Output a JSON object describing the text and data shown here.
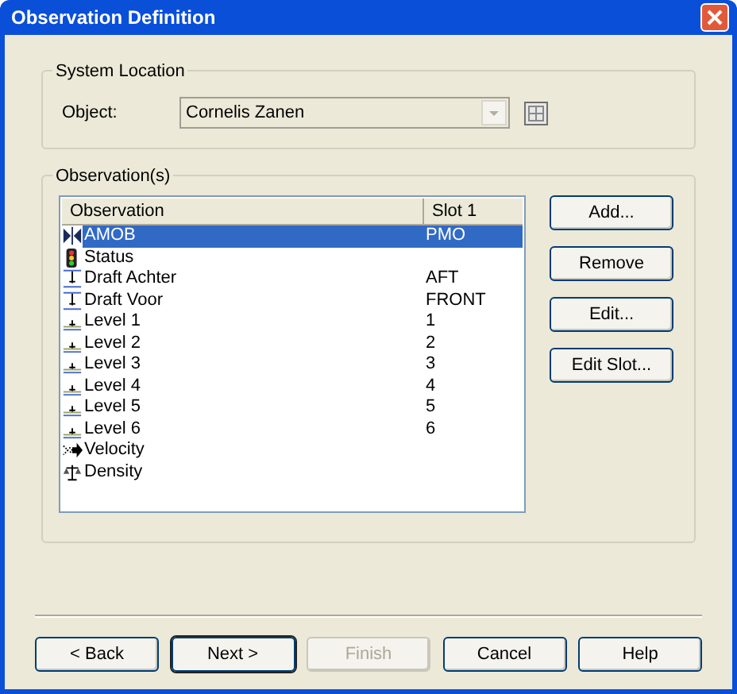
{
  "window": {
    "title": "Observation Definition"
  },
  "system_location": {
    "title": "System Location",
    "object_label": "Object:",
    "object_value": "Cornelis Zanen"
  },
  "observations": {
    "title": "Observation(s)",
    "columns": [
      "Observation",
      "Slot 1"
    ],
    "rows": [
      {
        "kind": "amob",
        "name": "AMOB",
        "slot": "PMO",
        "selected": true
      },
      {
        "kind": "status",
        "name": "Status",
        "selected": false
      },
      {
        "kind": "draft",
        "name": "Draft Achter",
        "slot": "AFT",
        "selected": false
      },
      {
        "kind": "draft",
        "name": "Draft Voor",
        "slot": "FRONT",
        "selected": false
      },
      {
        "kind": "level",
        "name": "Level 1",
        "slot": "1",
        "selected": false
      },
      {
        "kind": "level",
        "name": "Level 2",
        "slot": "2",
        "selected": false
      },
      {
        "kind": "level",
        "name": "Level 3",
        "slot": "3",
        "selected": false
      },
      {
        "kind": "level",
        "name": "Level 4",
        "slot": "4",
        "selected": false
      },
      {
        "kind": "level",
        "name": "Level 5",
        "slot": "5",
        "selected": false
      },
      {
        "kind": "level",
        "name": "Level 6",
        "slot": "6",
        "selected": false
      },
      {
        "kind": "velocity",
        "name": "Velocity",
        "selected": false
      },
      {
        "kind": "density",
        "name": "Density",
        "selected": false
      }
    ],
    "buttons": [
      "Add...",
      "Remove",
      "Edit...",
      "Edit Slot..."
    ]
  },
  "footer_buttons": [
    {
      "label": "< Back",
      "default": false,
      "disabled": false
    },
    {
      "label": "Next >",
      "default": true,
      "disabled": false
    },
    {
      "label": "Finish",
      "default": false,
      "disabled": true
    },
    {
      "label": "Cancel",
      "default": false,
      "disabled": false
    },
    {
      "label": "Help",
      "default": false,
      "disabled": false
    }
  ]
}
